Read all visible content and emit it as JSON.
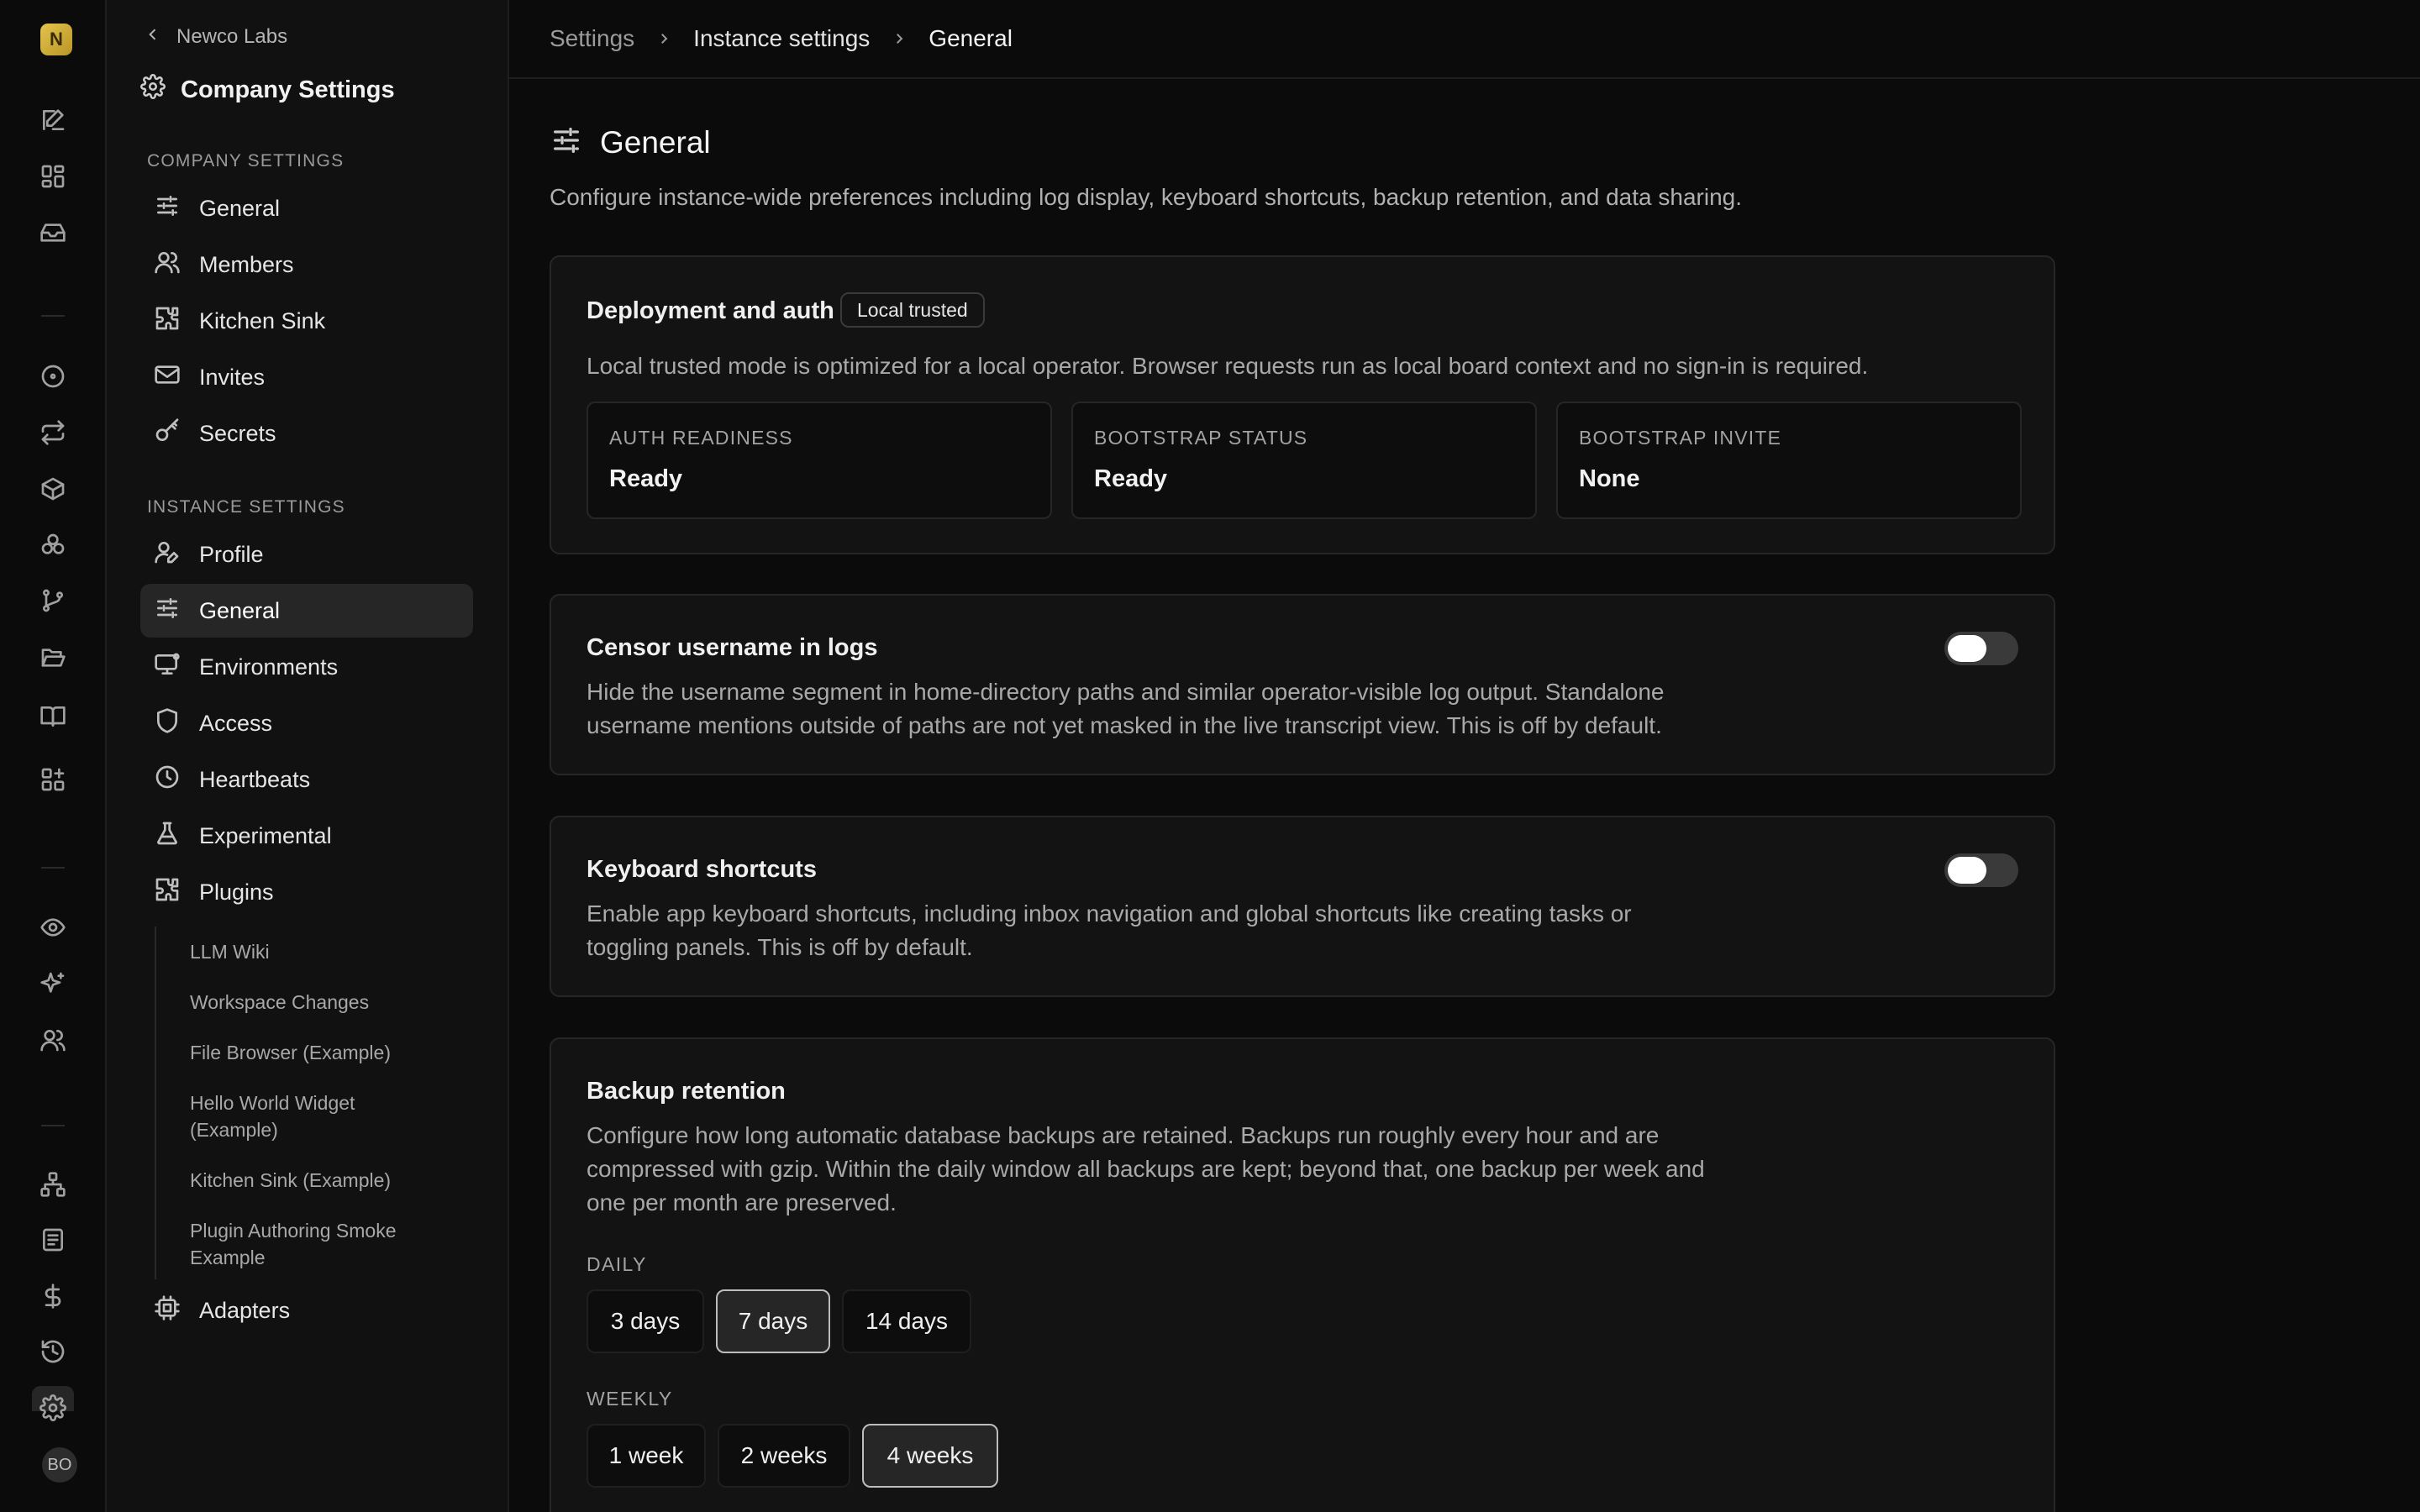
{
  "rail": {
    "logo_letter": "N",
    "avatar_initials": "BO"
  },
  "sidebar": {
    "back_label": "Newco Labs",
    "title": "Company Settings",
    "company_section_label": "COMPANY SETTINGS",
    "company_items": [
      {
        "label": "General",
        "icon": "sliders-icon"
      },
      {
        "label": "Members",
        "icon": "users-icon"
      },
      {
        "label": "Kitchen Sink",
        "icon": "puzzle-icon"
      },
      {
        "label": "Invites",
        "icon": "mail-icon"
      },
      {
        "label": "Secrets",
        "icon": "key-icon"
      }
    ],
    "instance_section_label": "INSTANCE SETTINGS",
    "instance_items": [
      {
        "label": "Profile",
        "icon": "user-pen-icon"
      },
      {
        "label": "General",
        "icon": "sliders-icon",
        "active": true
      },
      {
        "label": "Environments",
        "icon": "monitor-icon"
      },
      {
        "label": "Access",
        "icon": "shield-icon"
      },
      {
        "label": "Heartbeats",
        "icon": "clock-icon"
      },
      {
        "label": "Experimental",
        "icon": "flask-icon"
      },
      {
        "label": "Plugins",
        "icon": "puzzle-icon"
      }
    ],
    "plugin_items": [
      "LLM Wiki",
      "Workspace Changes",
      "File Browser (Example)",
      "Hello World Widget (Example)",
      "Kitchen Sink (Example)",
      "Plugin Authoring Smoke Example"
    ],
    "adapters_label": "Adapters"
  },
  "breadcrumb": {
    "root": "Settings",
    "section": "Instance settings",
    "current": "General"
  },
  "page": {
    "title": "General",
    "description": "Configure instance-wide preferences including log display, keyboard shortcuts, backup retention, and data sharing."
  },
  "deployment": {
    "title": "Deployment and auth",
    "badge": "Local trusted",
    "text": "Local trusted mode is optimized for a local operator. Browser requests run as local board context and no sign-in is required.",
    "stats": [
      {
        "label": "AUTH READINESS",
        "value": "Ready"
      },
      {
        "label": "BOOTSTRAP STATUS",
        "value": "Ready"
      },
      {
        "label": "BOOTSTRAP INVITE",
        "value": "None"
      }
    ]
  },
  "censor": {
    "title": "Censor username in logs",
    "text": "Hide the username segment in home-directory paths and similar operator-visible log output. Standalone username mentions outside of paths are not yet masked in the live transcript view. This is off by default.",
    "enabled": false
  },
  "shortcuts": {
    "title": "Keyboard shortcuts",
    "text": "Enable app keyboard shortcuts, including inbox navigation and global shortcuts like creating tasks or toggling panels. This is off by default.",
    "enabled": false
  },
  "backup": {
    "title": "Backup retention",
    "text": "Configure how long automatic database backups are retained. Backups run roughly every hour and are compressed with gzip. Within the daily window all backups are kept; beyond that, one backup per week and one per month are preserved.",
    "daily_label": "DAILY",
    "daily_options": [
      "3 days",
      "7 days",
      "14 days"
    ],
    "daily_selected": "7 days",
    "weekly_label": "WEEKLY",
    "weekly_options": [
      "1 week",
      "2 weeks",
      "4 weeks"
    ],
    "weekly_selected": "4 weeks"
  },
  "colors": {
    "background": "#0b0b0b",
    "sidebar": "#111111",
    "card": "#131313",
    "active": "#262626",
    "logo": "#e3c44d"
  }
}
